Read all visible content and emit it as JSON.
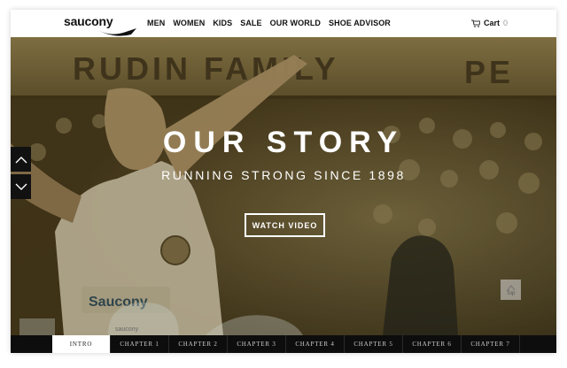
{
  "brand": {
    "logo_text": "saucony"
  },
  "nav": {
    "items": [
      "MEN",
      "WOMEN",
      "KIDS",
      "SALE",
      "OUR WORLD",
      "SHOE ADVISOR"
    ]
  },
  "cart": {
    "label": "Cart",
    "count": "0"
  },
  "hero": {
    "title": "OUR STORY",
    "subtitle": "RUNNING STRONG SINCE 1898",
    "button": "WATCH VIDEO",
    "banner_text": "RUDIN FAMILY",
    "banner_text_right": "PE",
    "bib_text": "Saucony",
    "bib_small_text": "saucony"
  },
  "side_nav": {
    "up_icon": "chevron-up-icon",
    "down_icon": "chevron-down-icon"
  },
  "top_button": {
    "label": "Top",
    "icon": "arrow-up-icon"
  },
  "chapters": {
    "items": [
      "INTRO",
      "CHAPTER 1",
      "CHAPTER 2",
      "CHAPTER 3",
      "CHAPTER 4",
      "CHAPTER 5",
      "CHAPTER 6",
      "CHAPTER 7"
    ],
    "active": "INTRO"
  },
  "colors": {
    "hero_overlay": "#6b5a2e",
    "chapter_bar": "#0d0d0d",
    "text": "#111111"
  }
}
